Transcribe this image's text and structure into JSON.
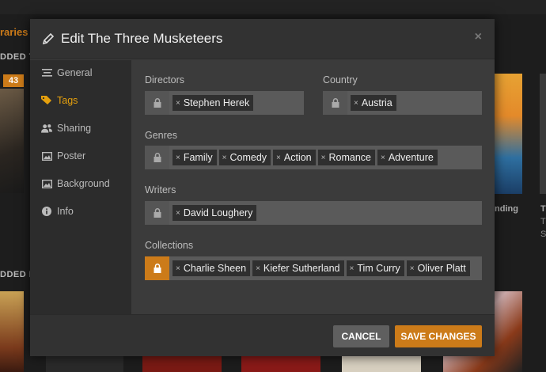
{
  "background": {
    "libraries_label": "raries",
    "added_label_1": "DDED T",
    "added_label_2": "DDED I",
    "badge_count": "43",
    "poster_caption_1": "nding",
    "poster_caption_2": "T",
    "poster_caption_3": "T",
    "poster_caption_4": "S"
  },
  "modal": {
    "title": "Edit The Three Musketeers",
    "close_label": "×",
    "sidebar": [
      {
        "label": "General",
        "icon": "general-icon"
      },
      {
        "label": "Tags",
        "icon": "tag-icon",
        "active": true
      },
      {
        "label": "Sharing",
        "icon": "users-icon"
      },
      {
        "label": "Poster",
        "icon": "image-icon"
      },
      {
        "label": "Background",
        "icon": "image-icon"
      },
      {
        "label": "Info",
        "icon": "info-icon"
      }
    ],
    "fields": {
      "directors": {
        "label": "Directors",
        "tags": [
          "Stephen Herek"
        ]
      },
      "country": {
        "label": "Country",
        "tags": [
          "Austria"
        ]
      },
      "genres": {
        "label": "Genres",
        "tags": [
          "Family",
          "Comedy",
          "Action",
          "Romance",
          "Adventure"
        ]
      },
      "writers": {
        "label": "Writers",
        "tags": [
          "David Loughery"
        ]
      },
      "collections": {
        "label": "Collections",
        "tags": [
          "Charlie Sheen",
          "Kiefer Sutherland",
          "Tim Curry",
          "Oliver Platt"
        ],
        "locked": true
      }
    },
    "tag_remove_glyph": "×",
    "buttons": {
      "cancel": "CANCEL",
      "save": "SAVE CHANGES"
    }
  },
  "colors": {
    "accent": "#cc7b19",
    "active_text": "#e5a00d"
  }
}
